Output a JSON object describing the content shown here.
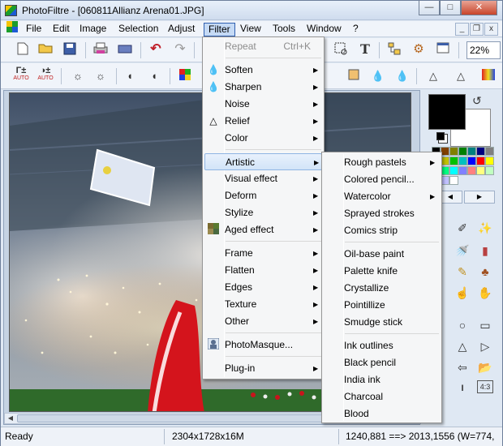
{
  "window": {
    "title": "PhotoFiltre - [060811Allianz Arena01.JPG]",
    "buttons": {
      "minimize": "—",
      "maximize": "□",
      "close": "✕"
    }
  },
  "menubar": {
    "items": [
      "File",
      "Edit",
      "Image",
      "Selection",
      "Adjust",
      "Filter",
      "View",
      "Tools",
      "Window",
      "?"
    ],
    "active": "Filter",
    "mdi_buttons": [
      "_",
      "❐",
      "x"
    ]
  },
  "toolbar": {
    "zoom": "22%",
    "auto_labels": [
      "AUTO",
      "AUTO"
    ],
    "text_tool": "T"
  },
  "statusbar": {
    "status": "Ready",
    "image_size": "2304x1728x16M",
    "coords": "1240,881 ==> 2013,1556 (W=774,"
  },
  "filter_menu": {
    "items": [
      {
        "label": "Repeat",
        "shortcut": "Ctrl+K",
        "disabled": true
      },
      {
        "label": "Soften",
        "submenu": true,
        "icon": "drop-icon"
      },
      {
        "label": "Sharpen",
        "submenu": true,
        "icon": "drop-icon"
      },
      {
        "label": "Noise",
        "submenu": true
      },
      {
        "label": "Relief",
        "submenu": true,
        "icon": "relief-icon"
      },
      {
        "label": "Color",
        "submenu": true
      },
      {
        "label": "Artistic",
        "submenu": true,
        "highlighted": true
      },
      {
        "label": "Visual effect",
        "submenu": true
      },
      {
        "label": "Deform",
        "submenu": true
      },
      {
        "label": "Stylize",
        "submenu": true
      },
      {
        "label": "Aged effect",
        "submenu": true,
        "icon": "aged-icon"
      },
      {
        "label": "Frame",
        "submenu": true
      },
      {
        "label": "Flatten",
        "submenu": true
      },
      {
        "label": "Edges",
        "submenu": true
      },
      {
        "label": "Texture",
        "submenu": true
      },
      {
        "label": "Other",
        "submenu": true
      },
      {
        "label": "PhotoMasque...",
        "icon": "photomasque-icon"
      },
      {
        "label": "Plug-in",
        "submenu": true
      }
    ]
  },
  "artistic_menu": {
    "items": [
      {
        "label": "Rough pastels",
        "submenu": true
      },
      {
        "label": "Colored pencil..."
      },
      {
        "label": "Watercolor",
        "submenu": true
      },
      {
        "label": "Sprayed strokes"
      },
      {
        "label": "Comics strip"
      },
      {
        "label": "Oil-base paint"
      },
      {
        "label": "Palette knife"
      },
      {
        "label": "Crystallize"
      },
      {
        "label": "Pointillize"
      },
      {
        "label": "Smudge stick"
      },
      {
        "label": "Ink outlines"
      },
      {
        "label": "Black pencil"
      },
      {
        "label": "India ink"
      },
      {
        "label": "Charcoal"
      },
      {
        "label": "Blood"
      }
    ]
  },
  "colors": {
    "menu_highlight": "#d2e4f8",
    "foreground": "#000000",
    "background": "#ffffff"
  }
}
